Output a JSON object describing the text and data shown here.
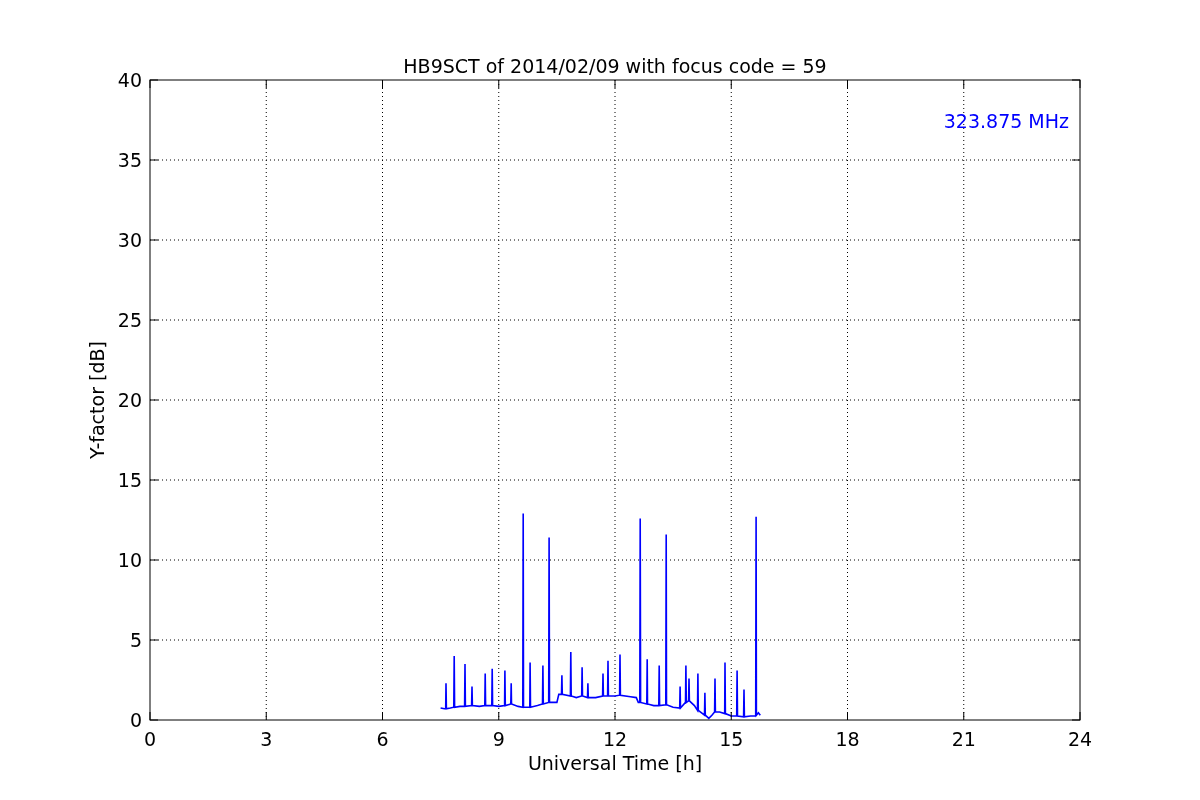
{
  "chart_data": {
    "type": "line",
    "title": "HB9SCT of 2014/02/09 with focus code = 59",
    "xlabel": "Universal Time [h]",
    "ylabel": "Y-factor [dB]",
    "x": [
      7.5,
      7.6,
      7.63,
      7.64,
      7.65,
      7.75,
      7.84,
      7.85,
      7.86,
      8.0,
      8.12,
      8.13,
      8.14,
      8.3,
      8.31,
      8.32,
      8.5,
      8.64,
      8.65,
      8.66,
      8.82,
      8.83,
      8.84,
      9.0,
      9.15,
      9.16,
      9.17,
      9.31,
      9.32,
      9.33,
      9.5,
      9.62,
      9.63,
      9.64,
      9.8,
      9.81,
      9.82,
      10.0,
      10.13,
      10.14,
      10.15,
      10.29,
      10.3,
      10.31,
      10.5,
      10.55,
      10.62,
      10.63,
      10.64,
      10.85,
      10.86,
      10.87,
      11.0,
      11.14,
      11.15,
      11.16,
      11.29,
      11.3,
      11.31,
      11.5,
      11.68,
      11.69,
      11.7,
      11.81,
      11.82,
      11.83,
      12.0,
      12.12,
      12.13,
      12.14,
      12.4,
      12.55,
      12.6,
      12.64,
      12.65,
      12.66,
      12.82,
      12.83,
      12.84,
      13.0,
      13.13,
      13.14,
      13.15,
      13.31,
      13.32,
      13.33,
      13.5,
      13.67,
      13.68,
      13.69,
      13.82,
      13.83,
      13.84,
      13.9,
      13.91,
      13.92,
      14.05,
      14.13,
      14.14,
      14.15,
      14.31,
      14.32,
      14.33,
      14.42,
      14.5,
      14.57,
      14.58,
      14.59,
      14.7,
      14.83,
      14.84,
      14.85,
      15.0,
      15.14,
      15.15,
      15.16,
      15.32,
      15.33,
      15.34,
      15.5,
      15.63,
      15.64,
      15.65,
      15.7,
      15.75
    ],
    "series": [
      {
        "color": "#0000ff",
        "values": [
          0.75,
          0.7,
          0.7,
          2.3,
          0.7,
          0.75,
          0.8,
          4.0,
          0.8,
          0.85,
          0.85,
          3.5,
          0.85,
          0.9,
          2.1,
          0.9,
          0.85,
          0.9,
          2.9,
          0.9,
          0.9,
          3.2,
          0.9,
          0.85,
          0.9,
          3.1,
          0.9,
          1.0,
          2.3,
          1.0,
          0.85,
          0.8,
          12.9,
          0.8,
          0.8,
          3.6,
          0.8,
          0.9,
          1.0,
          3.4,
          1.0,
          1.1,
          11.4,
          1.1,
          1.1,
          1.6,
          1.6,
          2.8,
          1.6,
          1.5,
          4.25,
          1.5,
          1.4,
          1.5,
          3.3,
          1.5,
          1.4,
          2.3,
          1.4,
          1.4,
          1.5,
          2.9,
          1.5,
          1.5,
          3.7,
          1.5,
          1.5,
          1.55,
          4.1,
          1.55,
          1.45,
          1.4,
          1.1,
          1.1,
          12.6,
          1.1,
          1.0,
          3.8,
          1.0,
          0.9,
          0.9,
          3.4,
          0.9,
          0.95,
          11.6,
          0.95,
          0.8,
          0.75,
          2.1,
          0.75,
          1.1,
          3.4,
          1.1,
          1.2,
          2.6,
          1.2,
          0.9,
          0.6,
          2.9,
          0.6,
          0.3,
          1.7,
          0.3,
          0.1,
          0.3,
          0.5,
          2.6,
          0.5,
          0.5,
          0.4,
          3.6,
          0.4,
          0.25,
          0.25,
          3.1,
          0.25,
          0.2,
          1.9,
          0.2,
          0.25,
          0.25,
          12.7,
          0.3,
          0.45,
          0.3
        ]
      }
    ],
    "xlim": [
      0,
      24
    ],
    "ylim": [
      0,
      40
    ],
    "xticks": [
      0,
      3,
      6,
      9,
      12,
      15,
      18,
      21,
      24
    ],
    "yticks": [
      0,
      5,
      10,
      15,
      20,
      25,
      30,
      35,
      40
    ],
    "grid": true,
    "annotations": [
      "323.875 MHz"
    ]
  }
}
